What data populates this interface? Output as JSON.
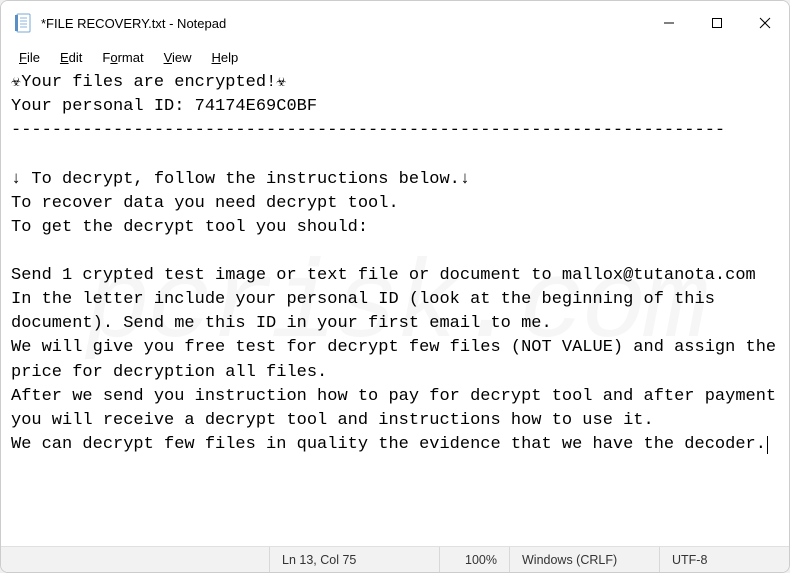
{
  "window": {
    "title": "*FILE RECOVERY.txt - Notepad"
  },
  "menu": {
    "file": "File",
    "edit": "Edit",
    "format": "Format",
    "view": "View",
    "help": "Help"
  },
  "document": {
    "line_header": "☣Your files are encrypted!☣",
    "line_id": "Your personal ID: 74174E69C0BF",
    "line_sep": "----------------------------------------------------------------------",
    "line_blank": "",
    "line_instr1": "↓ To decrypt, follow the instructions below.↓",
    "line_instr2": "To recover data you need decrypt tool.",
    "line_instr3": "To get the decrypt tool you should:",
    "line_send": "Send 1 crypted test image or text file or document to mallox@tutanota.com",
    "line_letter": "In the letter include your personal ID (look at the beginning of this document). Send me this ID in your first email to me.",
    "line_give": "We will give you free test for decrypt few files (NOT VALUE) and assign the price for decryption all files.",
    "line_after": "After we send you instruction how to pay for decrypt tool and after payment you will receive a decrypt tool and instructions how to use it.",
    "line_can": "We can decrypt few files in quality the evidence that we have the decoder."
  },
  "status": {
    "position": "Ln 13, Col 75",
    "zoom": "100%",
    "eol": "Windows (CRLF)",
    "encoding": "UTF-8"
  },
  "watermark": "pcrisk.com"
}
